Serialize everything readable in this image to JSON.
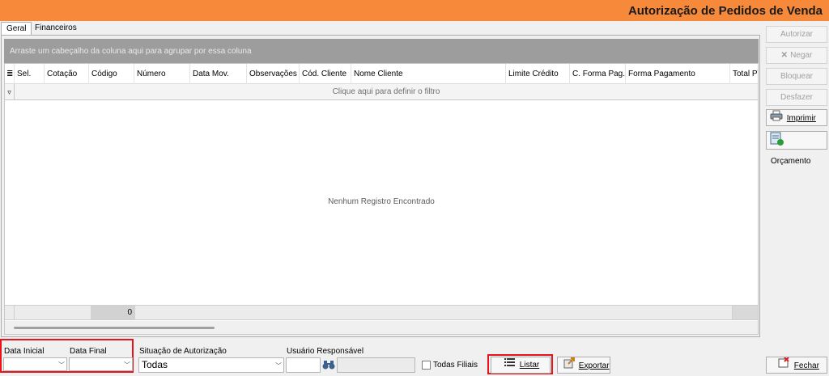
{
  "window": {
    "title": "Autorização de Pedidos de Venda",
    "accent_color": "#f7893a"
  },
  "tabs": [
    {
      "label": "Geral",
      "active": true
    },
    {
      "label": "Financeiros",
      "active": false
    }
  ],
  "grid": {
    "group_hint": "Arraste um cabeçalho da coluna aqui para agrupar por essa coluna",
    "columns": [
      "Sel.",
      "Cotação",
      "Código",
      "Número",
      "Data Mov.",
      "Observações",
      "Cód. Cliente",
      "Nome Cliente",
      "Limite Crédito",
      "C. Forma Pag.",
      "Forma Pagamento",
      "Total P\\"
    ],
    "filter_hint": "Clique aqui para definir o filtro",
    "empty_message": "Nenhum Registro Encontrado",
    "footer_count": "0"
  },
  "side_buttons": {
    "autorizar": "Autorizar",
    "negar": "Negar",
    "bloquear": "Bloquear",
    "desfazer": "Desfazer",
    "imprimir": "Imprimir",
    "orcamento": "Orçamento"
  },
  "filters": {
    "data_inicial_label": "Data Inicial",
    "data_final_label": "Data Final",
    "data_inicial_value": "",
    "data_final_value": "",
    "situacao_label": "Situação de Autorização",
    "situacao_value": "Todas",
    "usuario_label": "Usuário Responsável",
    "usuario_value": "",
    "todas_filiais_label": "Todas Filiais",
    "todas_filiais_checked": false
  },
  "actions": {
    "listar": "Listar",
    "exportar": "Exportar",
    "fechar": "Fechar"
  }
}
